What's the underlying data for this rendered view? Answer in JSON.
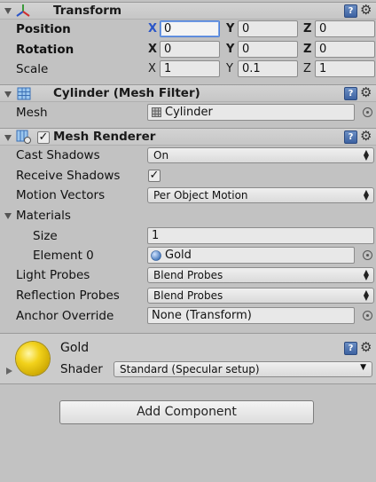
{
  "transform": {
    "title": "Transform",
    "rows": [
      {
        "label": "Position",
        "x": "0",
        "y": "0",
        "z": "0"
      },
      {
        "label": "Rotation",
        "x": "0",
        "y": "0",
        "z": "0"
      },
      {
        "label": "Scale",
        "x": "1",
        "y": "0.1",
        "z": "1"
      }
    ],
    "axes": {
      "x": "X",
      "y": "Y",
      "z": "Z"
    }
  },
  "mesh_filter": {
    "title": "Cylinder (Mesh Filter)",
    "mesh_label": "Mesh",
    "mesh_value": "Cylinder"
  },
  "mesh_renderer": {
    "title": "Mesh Renderer",
    "enabled": true,
    "cast_shadows_label": "Cast Shadows",
    "cast_shadows_value": "On",
    "receive_shadows_label": "Receive Shadows",
    "receive_shadows_checked": true,
    "motion_vectors_label": "Motion Vectors",
    "motion_vectors_value": "Per Object Motion",
    "materials_label": "Materials",
    "size_label": "Size",
    "size_value": "1",
    "element0_label": "Element 0",
    "element0_value": "Gold",
    "light_probes_label": "Light Probes",
    "light_probes_value": "Blend Probes",
    "reflection_probes_label": "Reflection Probes",
    "reflection_probes_value": "Blend Probes",
    "anchor_override_label": "Anchor Override",
    "anchor_override_value": "None (Transform)"
  },
  "material": {
    "name": "Gold",
    "shader_label": "Shader",
    "shader_value": "Standard (Specular setup)",
    "preview_color": "#f2d21b"
  },
  "add_component_label": "Add Component",
  "icons": {
    "help": "?",
    "check": "✓",
    "updown": "⬍"
  }
}
